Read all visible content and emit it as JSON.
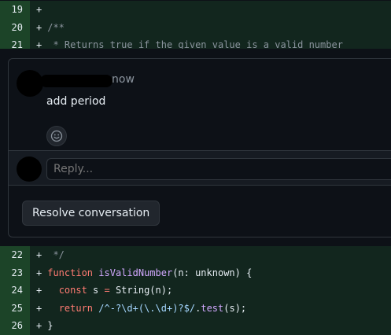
{
  "diff_top": [
    {
      "num": "19",
      "sign": "+",
      "tokens": []
    },
    {
      "num": "20",
      "sign": "+",
      "tokens": [
        {
          "t": "/**",
          "c": "cm"
        }
      ]
    },
    {
      "num": "21",
      "sign": "+",
      "tokens": [
        {
          "t": " * Returns true if the given value is a valid number",
          "c": "cm"
        }
      ]
    }
  ],
  "thread": {
    "comment": {
      "author": "",
      "timestamp": "now",
      "body": "add period",
      "reaction_icon": "smiley-icon"
    },
    "reply_placeholder": "Reply...",
    "resolve_label": "Resolve conversation"
  },
  "diff_bottom": [
    {
      "num": "22",
      "sign": "+",
      "tokens": [
        {
          "t": " */",
          "c": "cm"
        }
      ]
    },
    {
      "num": "23",
      "sign": "+",
      "tokens": [
        {
          "t": "function ",
          "c": "kw"
        },
        {
          "t": "isValidNumber",
          "c": "fn"
        },
        {
          "t": "(n: unknown) {",
          "c": ""
        }
      ]
    },
    {
      "num": "24",
      "sign": "+",
      "tokens": [
        {
          "t": "  ",
          "c": ""
        },
        {
          "t": "const",
          "c": "kw"
        },
        {
          "t": " s ",
          "c": ""
        },
        {
          "t": "=",
          "c": "kw"
        },
        {
          "t": " String(n);",
          "c": ""
        }
      ]
    },
    {
      "num": "25",
      "sign": "+",
      "tokens": [
        {
          "t": "  ",
          "c": ""
        },
        {
          "t": "return",
          "c": "kw"
        },
        {
          "t": " ",
          "c": ""
        },
        {
          "t": "/^-?\\d+(\\.\\d+)?$/",
          "c": "st"
        },
        {
          "t": ".",
          "c": ""
        },
        {
          "t": "test",
          "c": "fn"
        },
        {
          "t": "(s);",
          "c": ""
        }
      ]
    },
    {
      "num": "26",
      "sign": "+",
      "tokens": [
        {
          "t": "}",
          "c": ""
        }
      ]
    }
  ],
  "colors": {
    "added_line_bg": "#12261e",
    "added_num_bg": "#1c4428",
    "page_bg": "#0d1117",
    "border": "#30363d"
  }
}
